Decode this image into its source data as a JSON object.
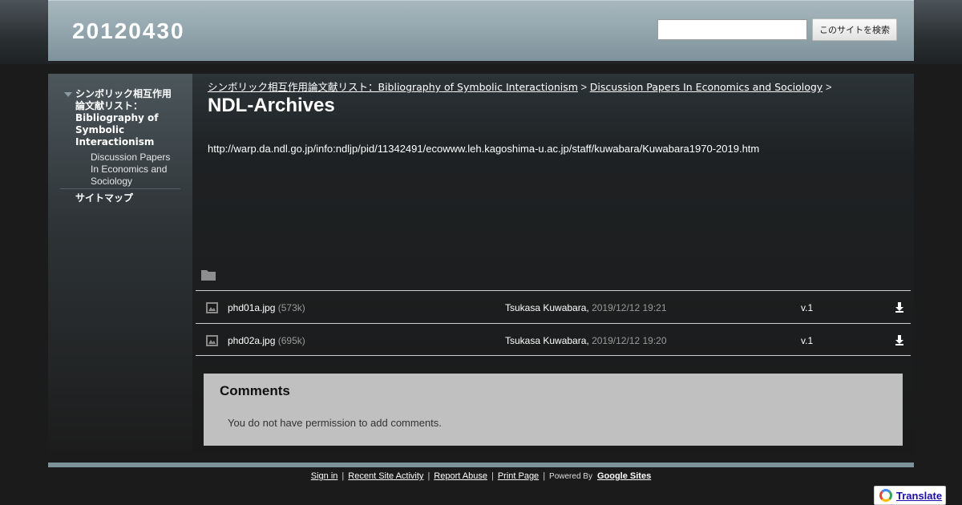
{
  "header": {
    "site_title": "20120430",
    "search": {
      "value": "",
      "button_label": "このサイトを検索"
    }
  },
  "sidebar": {
    "items": [
      {
        "label": "シンボリック相互作用論文献リスト：Bibliography of Symbolic Interactionism"
      },
      {
        "label": "Discussion Papers In Economics and Sociology"
      },
      {
        "label": "サイトマップ"
      }
    ]
  },
  "main": {
    "breadcrumb": {
      "link1": "シンボリック相互作用論文献リスト：Bibliography of Symbolic Interactionism",
      "link2": "Discussion Papers In Economics and Sociology",
      "separator": ">"
    },
    "title": "NDL-Archives",
    "url_text": "http://warp.da.ndl.go.jp/info:ndljp/pid/11342491/ecowww.leh.kagoshima-u.ac.jp/staff/kuwabara/Kuwabara1970-2019.htm",
    "files": [
      {
        "name": "phd01a.jpg",
        "size": "(573k)",
        "author": "Tsukasa Kuwabara,",
        "date": "2019/12/12 19:21",
        "version": "v.1"
      },
      {
        "name": "phd02a.jpg",
        "size": "(695k)",
        "author": "Tsukasa Kuwabara,",
        "date": "2019/12/12 19:20",
        "version": "v.1"
      }
    ],
    "comments": {
      "title": "Comments",
      "message": "You do not have permission to add comments."
    }
  },
  "footer": {
    "sign_in": "Sign in",
    "recent_activity": "Recent Site Activity",
    "report_abuse": "Report Abuse",
    "print_page": "Print Page",
    "separator": "|",
    "powered_by": "Powered By",
    "google_sites": "Google Sites"
  },
  "translate": {
    "label": "Translate"
  },
  "icons": {
    "folder": "folder-icon",
    "image": "image-file-icon",
    "download": "download-icon",
    "google_logo": "google-logo-icon",
    "nav_arrow": "triangle-down-icon"
  },
  "colors": {
    "header_accent": "#93a6ae",
    "background": "#1b1b1b",
    "comments_bg": "#c0c0c0"
  }
}
